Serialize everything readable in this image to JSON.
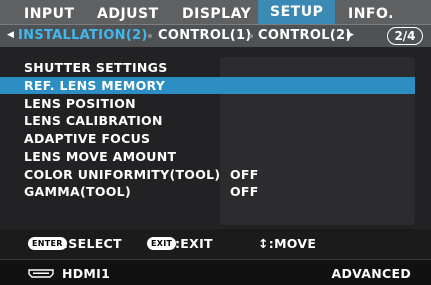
{
  "tabs": [
    "INPUT",
    "ADJUST",
    "DISPLAY",
    "SETUP",
    "INFO."
  ],
  "active_tab": "SETUP",
  "subtabs": [
    "INSTALLATION(2)",
    "CONTROL(1)",
    "CONTROL(2)"
  ],
  "page": "2/4",
  "menu": [
    {
      "label": "SHUTTER SETTINGS",
      "value": ""
    },
    {
      "label": "REF. LENS MEMORY",
      "value": ""
    },
    {
      "label": "LENS POSITION",
      "value": ""
    },
    {
      "label": "LENS CALIBRATION",
      "value": ""
    },
    {
      "label": "ADAPTIVE FOCUS",
      "value": ""
    },
    {
      "label": "LENS MOVE AMOUNT",
      "value": ""
    },
    {
      "label": "COLOR UNIFORMITY(TOOL)",
      "value": "OFF"
    },
    {
      "label": "GAMMA(TOOL)",
      "value": "OFF"
    }
  ],
  "help": {
    "enter_key": "ENTER",
    "select": ":SELECT",
    "exit_key": "EXIT",
    "exit": ":EXIT",
    "move": "↕:MOVE"
  },
  "status": {
    "source": "HDMI1",
    "mode": "ADVANCED"
  }
}
